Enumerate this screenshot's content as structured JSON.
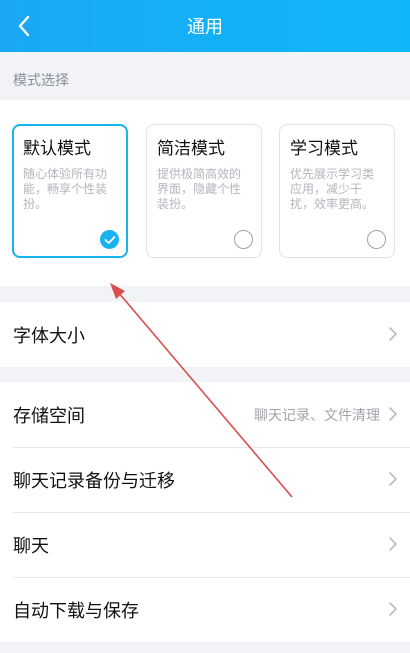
{
  "header": {
    "title": "通用"
  },
  "mode_section": {
    "label": "模式选择",
    "modes": [
      {
        "title": "默认模式",
        "desc": "随心体验所有功能，畅享个性装扮。",
        "selected": true
      },
      {
        "title": "简洁模式",
        "desc": "提供极简高效的界面，隐藏个性装扮。",
        "selected": false
      },
      {
        "title": "学习模式",
        "desc": "优先展示学习类应用，减少干扰，效率更高。",
        "selected": false
      }
    ]
  },
  "settings": {
    "font_size": {
      "label": "字体大小"
    },
    "storage": {
      "label": "存储空间",
      "value": "聊天记录、文件清理"
    },
    "backup": {
      "label": "聊天记录备份与迁移"
    },
    "chat": {
      "label": "聊天"
    },
    "auto_download": {
      "label": "自动下载与保存"
    }
  },
  "colors": {
    "accent": "#17b3ee",
    "header": "#14aff4",
    "annotation_arrow": "#d94f4f"
  },
  "icons": {
    "back": "chevron-left-icon",
    "row_arrow": "chevron-right-icon",
    "selected": "check-circle-icon",
    "unselected": "radio-circle-icon"
  }
}
